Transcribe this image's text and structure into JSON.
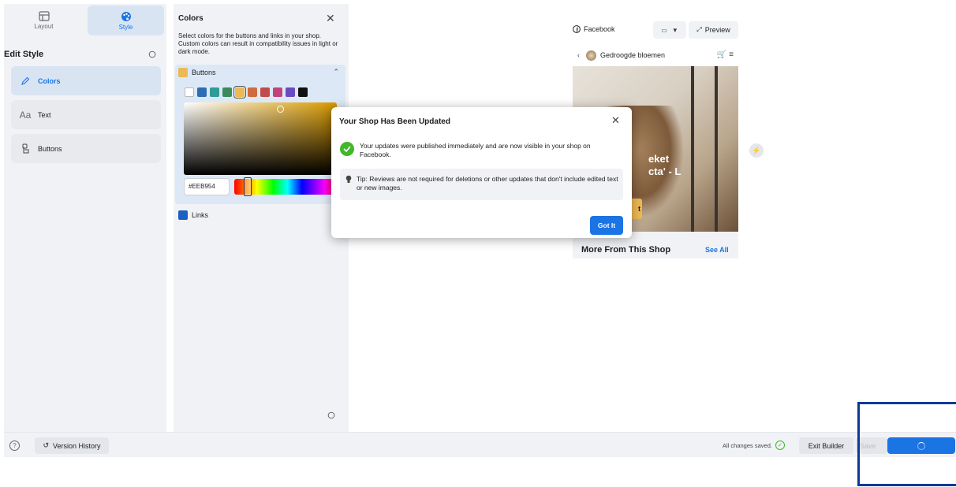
{
  "tabs": [
    {
      "label": "Layout",
      "icon": "layout-icon",
      "active": false
    },
    {
      "label": "Style",
      "icon": "palette-icon",
      "active": true
    }
  ],
  "sidebar": {
    "title": "Edit Style",
    "items": [
      {
        "label": "Colors",
        "icon": "pen-icon",
        "active": true
      },
      {
        "label": "Text",
        "icon": "text-aa-icon",
        "active": false
      },
      {
        "label": "Buttons",
        "icon": "tap-icon",
        "active": false
      }
    ]
  },
  "colors_panel": {
    "title": "Colors",
    "description": "Select colors for the buttons and links in your shop. Custom colors can result in compatibility issues in light or dark mode.",
    "buttons_section": {
      "label": "Buttons",
      "current_color": "#eeb954",
      "swatches": [
        "#ffffff",
        "#2d6db5",
        "#2f9c95",
        "#3b8b5a",
        "#eeb954",
        "#cf6b3c",
        "#c14a4a",
        "#c2437a",
        "#6a4ac2",
        "#111111"
      ],
      "selected_index": 4,
      "hex_value": "#EEB954"
    },
    "links_section": {
      "label": "Links",
      "color": "#1b5fc4"
    }
  },
  "preview": {
    "platform_label": "Facebook",
    "preview_label": "Preview",
    "shop_name": "Gedroogde bloemen",
    "hero_title_line1": "eket",
    "hero_title_line2": "cta' - L",
    "hero_button_text": "t",
    "more_from_shop": "More From This Shop",
    "see_all": "See All"
  },
  "modal": {
    "title": "Your Shop Has Been Updated",
    "message": "Your updates were published immediately and are now visible in your shop on Facebook.",
    "tip": "Tip: Reviews are not required for deletions or other updates that don't include edited text or new images.",
    "button": "Got It"
  },
  "footer": {
    "help_label": "?",
    "version_history": "Version History",
    "saved_status": "All changes saved.",
    "exit_builder": "Exit Builder",
    "save": "Save"
  },
  "colors": {
    "accent": "#1b74e4",
    "success": "#42b72a",
    "highlight": "#0b3a96"
  }
}
